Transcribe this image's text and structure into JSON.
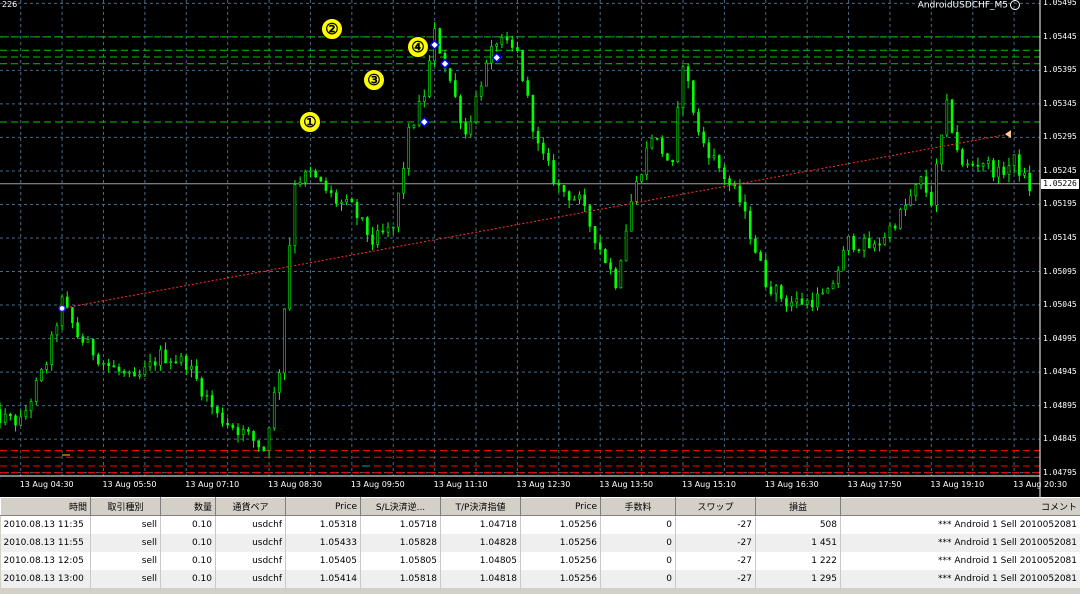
{
  "chart_window": {
    "title": "AndroidUSDCHF_M5",
    "corner_label": "226",
    "current_price": "1.05226",
    "markers": [
      "①",
      "②",
      "③",
      "④"
    ]
  },
  "colors": {
    "background": "#000000",
    "candle": "#00ff00",
    "grid": "#4a6a88",
    "green_levels": "#00c800",
    "red_levels": "#ff0000",
    "trend_line": "#ff3030",
    "marker_fill": "#ffff00",
    "trade_marker": "#0000ff"
  },
  "chart_data": {
    "type": "candlestick",
    "symbol": "USDCHF",
    "timeframe": "M5",
    "y_axis_ticks": [
      "1.05495",
      "1.05445",
      "1.05395",
      "1.05345",
      "1.05295",
      "1.05245",
      "1.05195",
      "1.05145",
      "1.05095",
      "1.05045",
      "1.04995",
      "1.04945",
      "1.04895",
      "1.04845",
      "1.04795"
    ],
    "ylim": [
      1.0479,
      1.055
    ],
    "x_axis_ticks": [
      "13 Aug 04:30",
      "13 Aug 05:50",
      "13 Aug 07:10",
      "13 Aug 08:30",
      "13 Aug 09:50",
      "13 Aug 11:10",
      "13 Aug 12:30",
      "13 Aug 13:50",
      "13 Aug 15:10",
      "13 Aug 16:30",
      "13 Aug 17:50",
      "13 Aug 19:10",
      "13 Aug 20:30"
    ],
    "close_path": [
      [
        "04:00",
        1.0488
      ],
      [
        "04:30",
        1.0487
      ],
      [
        "04:55",
        1.0496
      ],
      [
        "05:10",
        1.0505
      ],
      [
        "05:25",
        1.05
      ],
      [
        "05:50",
        1.0496
      ],
      [
        "06:20",
        1.0493
      ],
      [
        "06:45",
        1.0497
      ],
      [
        "07:10",
        1.0496
      ],
      [
        "07:40",
        1.0488
      ],
      [
        "08:10",
        1.0485
      ],
      [
        "08:25",
        1.0483
      ],
      [
        "08:40",
        1.0495
      ],
      [
        "08:55",
        1.0523
      ],
      [
        "09:10",
        1.0524
      ],
      [
        "09:35",
        1.052
      ],
      [
        "09:50",
        1.0519
      ],
      [
        "10:10",
        1.0514
      ],
      [
        "10:30",
        1.0516
      ],
      [
        "10:45",
        1.053
      ],
      [
        "11:00",
        1.0536
      ],
      [
        "11:10",
        1.0545
      ],
      [
        "11:25",
        1.0538
      ],
      [
        "11:40",
        1.053
      ],
      [
        "11:55",
        1.0538
      ],
      [
        "12:10",
        1.0544
      ],
      [
        "12:30",
        1.0542
      ],
      [
        "12:50",
        1.0528
      ],
      [
        "13:10",
        1.0522
      ],
      [
        "13:30",
        1.052
      ],
      [
        "13:50",
        1.0513
      ],
      [
        "14:05",
        1.0508
      ],
      [
        "14:20",
        1.052
      ],
      [
        "14:40",
        1.053
      ],
      [
        "15:00",
        1.0525
      ],
      [
        "15:10",
        1.0541
      ],
      [
        "15:25",
        1.053
      ],
      [
        "15:45",
        1.0525
      ],
      [
        "16:05",
        1.052
      ],
      [
        "16:30",
        1.0508
      ],
      [
        "16:50",
        1.0505
      ],
      [
        "17:10",
        1.0505
      ],
      [
        "17:30",
        1.0506
      ],
      [
        "17:50",
        1.0514
      ],
      [
        "18:15",
        1.0513
      ],
      [
        "18:40",
        1.0518
      ],
      [
        "19:00",
        1.0523
      ],
      [
        "19:10",
        1.052
      ],
      [
        "19:25",
        1.0534
      ],
      [
        "19:40",
        1.0525
      ],
      [
        "20:00",
        1.0526
      ],
      [
        "20:15",
        1.0524
      ],
      [
        "20:30",
        1.0526
      ],
      [
        "20:45",
        1.0522
      ]
    ],
    "trend_line": {
      "from": [
        "05:10",
        1.0504
      ],
      "to": [
        "20:25",
        1.053
      ]
    },
    "horizontal_levels": {
      "green_dashed": [
        1.05445,
        1.05425,
        1.05415,
        1.05405,
        1.05318
      ],
      "red_dashed": [
        1.04828,
        1.04818,
        1.04805,
        1.04795
      ]
    },
    "trade_markers": [
      {
        "label": "①",
        "time": "11:00",
        "price": 1.05318
      },
      {
        "label": "②",
        "time": "11:10",
        "price": 1.05433
      },
      {
        "label": "③",
        "time": "11:20",
        "price": 1.05405
      },
      {
        "label": "④",
        "time": "12:10",
        "price": 1.05414
      }
    ]
  },
  "terminal": {
    "columns": [
      "時間",
      "取引種別",
      "数量",
      "通貨ペア",
      "Price",
      "S/L決済逆...",
      "T/P決済指値",
      "Price",
      "手数料",
      "スワップ",
      "損益",
      "コメント"
    ],
    "rows": [
      [
        "2010.08.13 11:35",
        "sell",
        "0.10",
        "usdchf",
        "1.05318",
        "1.05718",
        "1.04718",
        "1.05256",
        "0",
        "-27",
        "508",
        "*** Android 1 Sell 2010052081"
      ],
      [
        "2010.08.13 11:55",
        "sell",
        "0.10",
        "usdchf",
        "1.05433",
        "1.05828",
        "1.04828",
        "1.05256",
        "0",
        "-27",
        "1 451",
        "*** Android 1 Sell 2010052081"
      ],
      [
        "2010.08.13 12:05",
        "sell",
        "0.10",
        "usdchf",
        "1.05405",
        "1.05805",
        "1.04805",
        "1.05256",
        "0",
        "-27",
        "1 222",
        "*** Android 1 Sell 2010052081"
      ],
      [
        "2010.08.13 13:00",
        "sell",
        "0.10",
        "usdchf",
        "1.05414",
        "1.05818",
        "1.04818",
        "1.05256",
        "0",
        "-27",
        "1 295",
        "*** Android 1 Sell 2010052081"
      ]
    ]
  }
}
